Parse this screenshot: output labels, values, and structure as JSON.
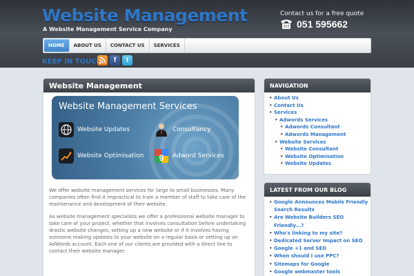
{
  "header": {
    "title": "Website Management",
    "subtitle": "A Website Management Service Company",
    "contact_text": "Contact us for a free quote",
    "phone": "051 595662"
  },
  "nav": {
    "items": [
      {
        "label": "HOME",
        "active": true
      },
      {
        "label": "ABOUT US"
      },
      {
        "label": "CONTACT US"
      },
      {
        "label": "SERVICES"
      }
    ]
  },
  "social": {
    "label": "KEEP IN TOUCH",
    "icons": [
      "rss-icon",
      "facebook-icon",
      "twitter-icon"
    ]
  },
  "main": {
    "heading": "Website Management",
    "banner": {
      "title": "Website Management Services",
      "items": [
        "Website Updates",
        "Consultancy",
        "Website Optimisation",
        "Adword Services"
      ]
    },
    "paragraphs": [
      "We offer website management services for large to small businesses. Many companies often find it impractical to train a member of staff to take care of the maintenance and development of their website.",
      "As website management specialists we offer a professional website manager to take care of your project, whether that involves consultation before undertaking drastic website changes, setting up a new website or if it involves having someone making updates to your website on a regular basis or setting up an AdWords account. Each one of our clients are provided with a direct line to contact their website manager."
    ]
  },
  "navigation_panel": {
    "heading": "NAVIGATION",
    "items": [
      {
        "label": "About Us",
        "level": 1
      },
      {
        "label": "Contact Us",
        "level": 1
      },
      {
        "label": "Services",
        "level": 1
      },
      {
        "label": "Adwords Services",
        "level": 2
      },
      {
        "label": "Adwords Consultant",
        "level": 3
      },
      {
        "label": "Adwords Management",
        "level": 3
      },
      {
        "label": "Website Services",
        "level": 2
      },
      {
        "label": "Website Consultant",
        "level": 3
      },
      {
        "label": "Website Optimisation",
        "level": 3
      },
      {
        "label": "Website Updates",
        "level": 3
      }
    ]
  },
  "blog_panel": {
    "heading": "LATEST FROM OUR BLOG",
    "items": [
      "Google Announces Mobile Friendly",
      "Search Results",
      "Are Website Builders SEO",
      "Friendly...?",
      "Who's linking to my site?",
      "Dedicated Server Impact on SEO",
      "Google +1 and SEO",
      "When should I use PPC?",
      "Sitemaps for Google",
      "Google webmaster tools"
    ]
  },
  "colors": {
    "accent": "#2e76c7",
    "header_bg": "#3a3f45",
    "page_bg": "#dfe5ea"
  }
}
